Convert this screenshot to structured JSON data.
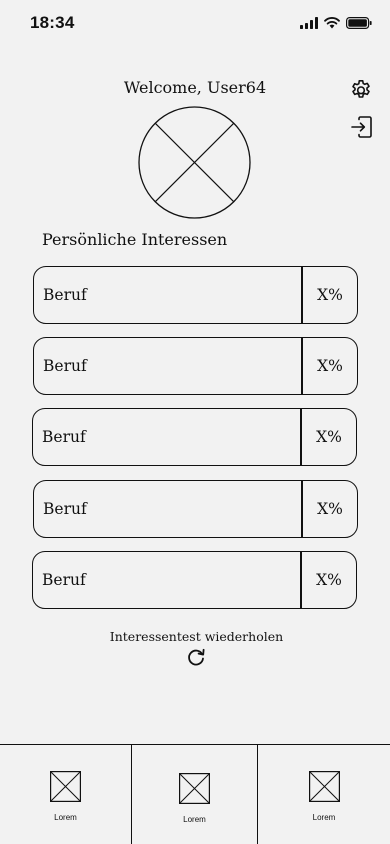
{
  "status_bar": {
    "time": "18:34",
    "icons": [
      "signal-icon",
      "wifi-icon",
      "battery-icon"
    ]
  },
  "header": {
    "welcome_text": "Welcome, User64",
    "settings_icon": "gear-icon",
    "logout_icon": "logout-icon"
  },
  "avatar": {
    "icon": "placeholder-image-icon"
  },
  "interests": {
    "title": "Persönliche Interessen",
    "items": [
      {
        "label": "Beruf",
        "percent": "X%"
      },
      {
        "label": "Beruf",
        "percent": "X%"
      },
      {
        "label": "Beruf",
        "percent": "X%"
      },
      {
        "label": "Beruf",
        "percent": "X%"
      },
      {
        "label": "Beruf",
        "percent": "X%"
      }
    ]
  },
  "retest": {
    "label": "Interessentest wiederholen",
    "icon": "refresh-icon"
  },
  "tab_bar": {
    "tabs": [
      {
        "label": "Lorem",
        "icon": "placeholder-image-icon"
      },
      {
        "label": "Lorem",
        "icon": "placeholder-image-icon"
      },
      {
        "label": "Lorem",
        "icon": "placeholder-image-icon"
      }
    ]
  }
}
